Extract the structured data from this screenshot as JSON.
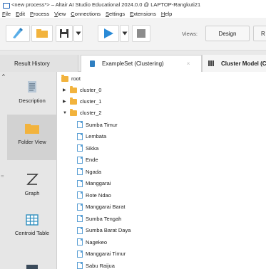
{
  "window": {
    "title": "<new process*> – Altair AI Studio Educational 2024.0.0 @ LAPTOP-Rangkuti21"
  },
  "menu": [
    {
      "mnemonic": "F",
      "rest": "ile"
    },
    {
      "mnemonic": "E",
      "rest": "dit"
    },
    {
      "mnemonic": "P",
      "rest": "rocess"
    },
    {
      "mnemonic": "V",
      "rest": "iew"
    },
    {
      "mnemonic": "C",
      "rest": "onnections"
    },
    {
      "mnemonic": "S",
      "rest": "ettings"
    },
    {
      "mnemonic": "E",
      "rest": "xtensions"
    },
    {
      "mnemonic": "H",
      "rest": "elp"
    }
  ],
  "toolbar": {
    "views_label": "Views:",
    "design_label": "Design",
    "results_label": "R"
  },
  "tabs": {
    "result_history": "Result History",
    "exampleset": "ExampleSet (Clustering)",
    "exampleset_close": "×",
    "cluster_model": "Cluster Model (Cl"
  },
  "sidebar": {
    "scroll_arrow": "^",
    "grip": "=",
    "items": [
      {
        "label": "Description"
      },
      {
        "label": "Folder View"
      },
      {
        "label": "Graph"
      },
      {
        "label": "Centroid Table"
      }
    ]
  },
  "tree": {
    "root": "root",
    "clusters": [
      {
        "name": "cluster_0",
        "expanded": false
      },
      {
        "name": "cluster_1",
        "expanded": false
      },
      {
        "name": "cluster_2",
        "expanded": true
      }
    ],
    "leaves": [
      "Sumba Timur",
      "Lembata",
      "Sikka",
      "Ende",
      "Ngada",
      "Manggarai",
      "Rote Ndao",
      "Manggarai Barat",
      "Sumba Tengah",
      "Sumba Barat Daya",
      "Nagekeo",
      "Manggarai Timur",
      "Sabu Raijua"
    ]
  },
  "colors": {
    "folder": "#f2b33d",
    "run_blue": "#2a8ad6",
    "sidebar_bg": "#e6e6e6",
    "selected_side": "#d2d2d2"
  }
}
